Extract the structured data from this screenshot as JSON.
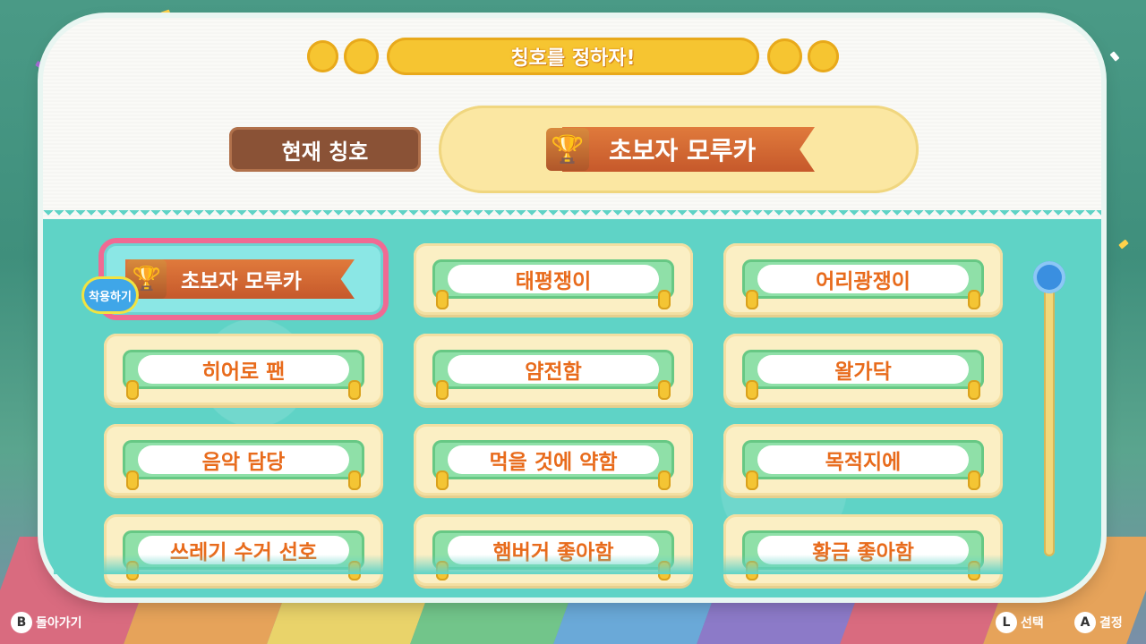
{
  "header": {
    "title": "칭호를 정하자!"
  },
  "current": {
    "label": "현재 칭호",
    "title": "초보자 모루카"
  },
  "titles": [
    "초보자 모루카",
    "태평쟁이",
    "어리광쟁이",
    "히어로 팬",
    "얌전함",
    "왈가닥",
    "음악 담당",
    "먹을 것에 약함",
    "목적지에",
    "쓰레기 수거 선호",
    "햄버거 좋아함",
    "황금 좋아함"
  ],
  "equipped_badge": "착용하기",
  "footer": {
    "back_button": "B",
    "back_label": "돌아가기",
    "select_button": "L",
    "select_label": "선택",
    "confirm_button": "A",
    "confirm_label": "결정"
  },
  "scroll": {
    "position": 0
  }
}
